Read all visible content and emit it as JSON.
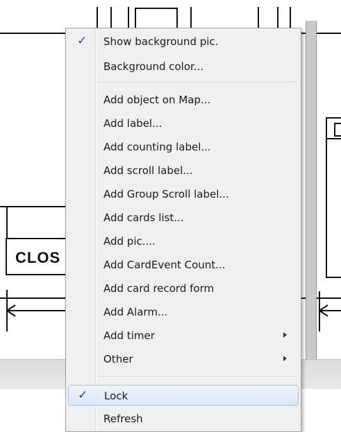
{
  "background": {
    "close_label": "CLOS"
  },
  "menu": {
    "items": [
      {
        "label": "Show background pic.",
        "checked": true
      },
      {
        "label": "Background color...",
        "checked": false
      },
      {
        "label": "Add object on Map...",
        "checked": false
      },
      {
        "label": "Add label...",
        "checked": false
      },
      {
        "label": "Add counting label...",
        "checked": false
      },
      {
        "label": "Add scroll label...",
        "checked": false
      },
      {
        "label": "Add Group Scroll label...",
        "checked": false
      },
      {
        "label": "Add cards list...",
        "checked": false
      },
      {
        "label": "Add pic....",
        "checked": false
      },
      {
        "label": "Add CardEvent Count...",
        "checked": false
      },
      {
        "label": "Add card record form",
        "checked": false
      },
      {
        "label": "Add Alarm...",
        "checked": false
      },
      {
        "label": "Add timer",
        "checked": false,
        "submenu": true
      },
      {
        "label": "Other",
        "checked": false,
        "submenu": true
      },
      {
        "label": "Lock",
        "checked": true,
        "highlighted": true
      },
      {
        "label": "Refresh",
        "checked": false
      }
    ],
    "check_glyph": "✓"
  },
  "colors": {
    "menu_bg": "#f0f0f0",
    "highlight_border": "#a9c4e4",
    "check_color": "#1b4d8c"
  }
}
